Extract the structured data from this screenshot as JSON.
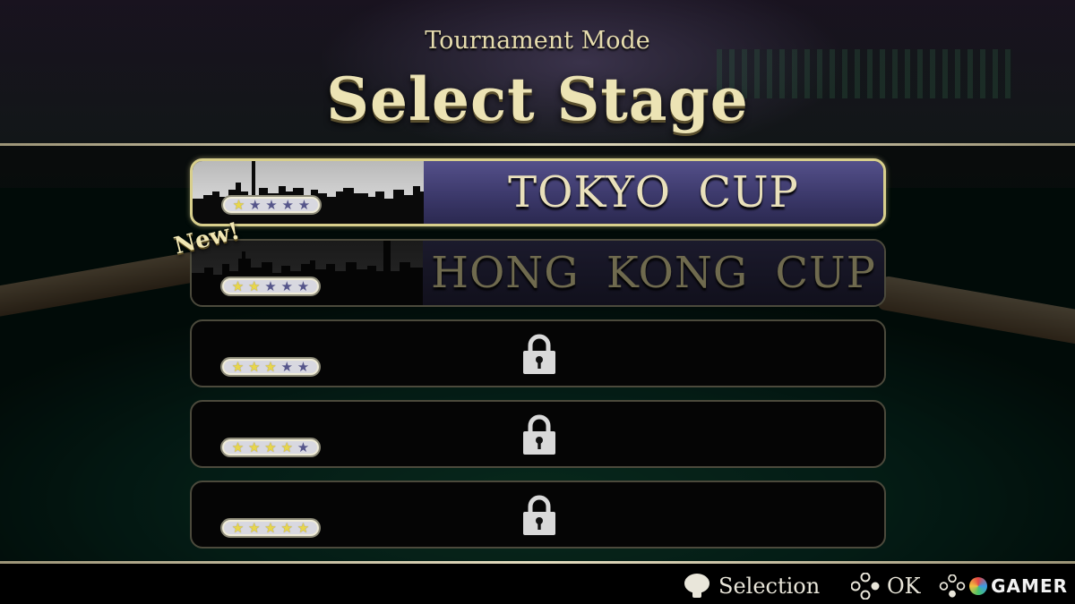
{
  "header": {
    "subtitle": "Tournament Mode",
    "title": "Select Stage"
  },
  "new_badge": "New!",
  "stages": [
    {
      "name": "TOKYO CUP",
      "stars": 1,
      "max_stars": 5,
      "locked": false,
      "selected": true,
      "skyline": "tokyo-skyline"
    },
    {
      "name": "HONG KONG CUP",
      "stars": 2,
      "max_stars": 5,
      "locked": false,
      "selected": false,
      "skyline": "hong-kong-skyline"
    },
    {
      "name": "",
      "stars": 3,
      "max_stars": 5,
      "locked": true,
      "selected": false
    },
    {
      "name": "",
      "stars": 4,
      "max_stars": 5,
      "locked": true,
      "selected": false
    },
    {
      "name": "",
      "stars": 5,
      "max_stars": 5,
      "locked": true,
      "selected": false
    }
  ],
  "footer": {
    "selection_label": "Selection",
    "ok_label": "OK",
    "watermark": "GAMER"
  },
  "colors": {
    "gold_text": "#ece3b4",
    "selected_border": "#d8cf8c",
    "selected_name_bg": "#3a3768",
    "star_on": "#e8d64a",
    "star_off": "#55558a"
  }
}
